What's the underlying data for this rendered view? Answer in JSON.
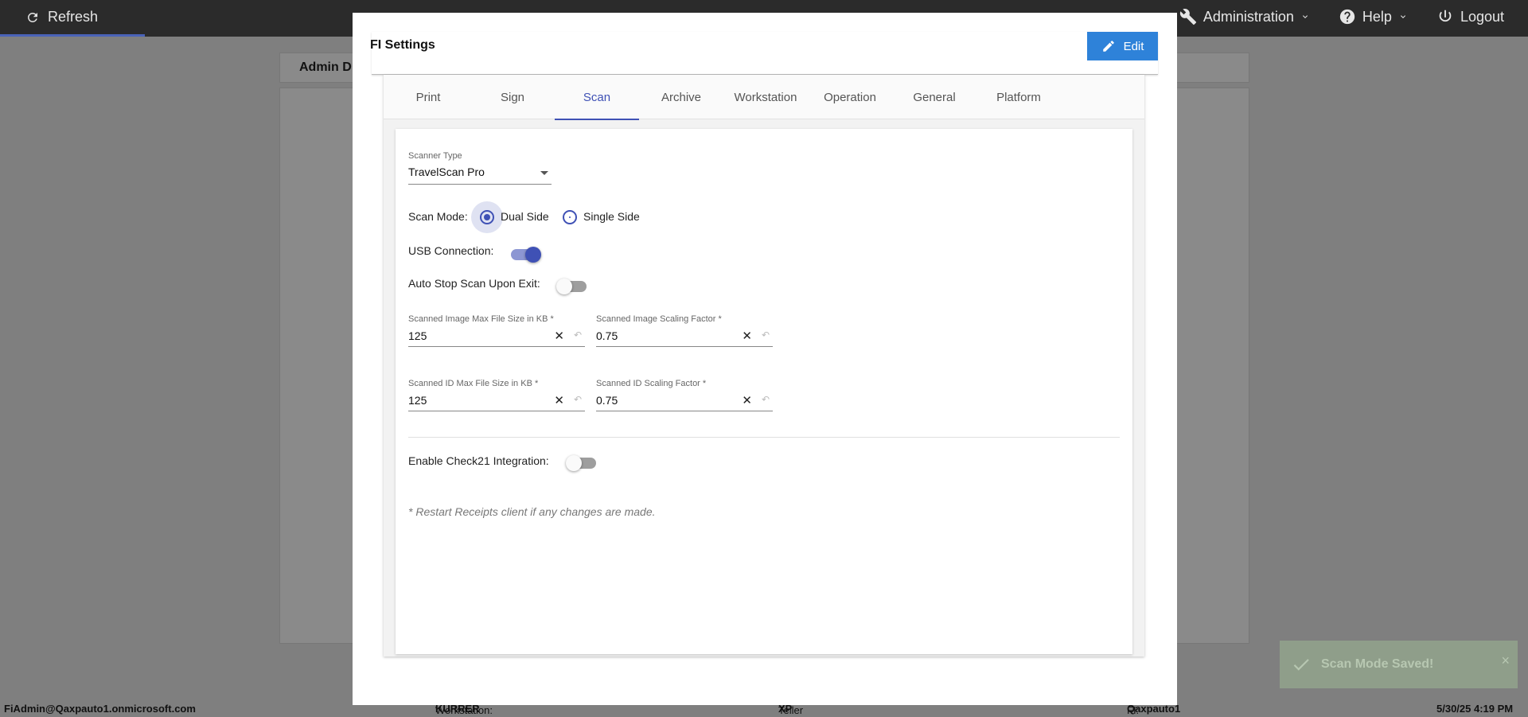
{
  "topbar": {
    "refresh_label": "Refresh",
    "nav": {
      "administration": "Administration",
      "help": "Help",
      "logout": "Logout"
    }
  },
  "background": {
    "card_title": "Admin D"
  },
  "modal": {
    "title": "FI Settings",
    "edit_label": "Edit",
    "tabs": [
      "Print",
      "Sign",
      "Scan",
      "Archive",
      "Workstation",
      "Operation",
      "General",
      "Platform"
    ],
    "active_tab": "Scan",
    "scan": {
      "scanner_type_label": "Scanner Type",
      "scanner_type_value": "TravelScan Pro",
      "scan_mode_label": "Scan Mode:",
      "scan_mode_options": [
        "Dual Side",
        "Single Side"
      ],
      "scan_mode_selected": "Dual Side",
      "usb_label": "USB Connection:",
      "usb_on": true,
      "auto_stop_label": "Auto Stop Scan Upon Exit:",
      "auto_stop_on": false,
      "image_max_label": "Scanned Image Max File Size in KB *",
      "image_max_value": "125",
      "image_scale_label": "Scanned Image Scaling Factor *",
      "image_scale_value": "0.75",
      "id_max_label": "Scanned ID Max File Size in KB *",
      "id_max_value": "125",
      "id_scale_label": "Scanned ID Scaling Factor *",
      "id_scale_value": "0.75",
      "check21_label": "Enable Check21 Integration:",
      "check21_on": false,
      "note": "* Restart Receipts client if any changes are made."
    }
  },
  "footer": {
    "user": "FiAdmin@Qaxpauto1.onmicrosoft.com",
    "workstation_label": "Workstation:",
    "workstation_value": "KURRER",
    "platform_label": "Teller Platform:",
    "platform_value": "XP",
    "fi_label": "FI:",
    "fi_value": "Qaxpauto1",
    "datetime": "5/30/25 4:19 PM"
  },
  "toast": {
    "message": "Scan Mode Saved!",
    "close": "×"
  },
  "colors": {
    "accent": "#3f51b5",
    "edit_button": "#2e82d9",
    "topbar": "#2b2b2b"
  },
  "icons": {
    "refresh": "refresh-icon",
    "wrench": "wrench-icon",
    "help": "help-icon",
    "power": "power-icon",
    "pencil": "pencil-icon",
    "check": "check-icon"
  }
}
